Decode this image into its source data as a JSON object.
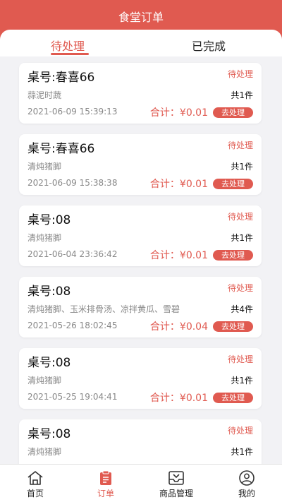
{
  "header": {
    "title": "食堂订单"
  },
  "tabs": [
    {
      "label": "待处理",
      "active": true
    },
    {
      "label": "已完成",
      "active": false
    }
  ],
  "orders": [
    {
      "table": "桌号:春喜66",
      "status": "待处理",
      "items": "蒜泥时蔬",
      "count": "共1件",
      "time": "2021-06-09 15:39:13",
      "total": "合计：¥0.01",
      "action": "去处理"
    },
    {
      "table": "桌号:春喜66",
      "status": "待处理",
      "items": "清炖猪脚",
      "count": "共1件",
      "time": "2021-06-09 15:38:38",
      "total": "合计：¥0.01",
      "action": "去处理"
    },
    {
      "table": "桌号:08",
      "status": "待处理",
      "items": "清炖猪脚",
      "count": "共1件",
      "time": "2021-06-04 23:36:42",
      "total": "合计：¥0.01",
      "action": "去处理"
    },
    {
      "table": "桌号:08",
      "status": "待处理",
      "items": "清炖猪脚、玉米排骨汤、凉拌黄瓜、雪碧",
      "count": "共4件",
      "time": "2021-05-26 18:02:45",
      "total": "合计：¥0.04",
      "action": "去处理"
    },
    {
      "table": "桌号:08",
      "status": "待处理",
      "items": "清炖猪脚",
      "count": "共1件",
      "time": "2021-05-25 19:04:41",
      "total": "合计：¥0.01",
      "action": "去处理"
    },
    {
      "table": "桌号:08",
      "status": "待处理",
      "items": "清炖猪脚",
      "count": "共1件",
      "time": "",
      "total": "",
      "action": ""
    }
  ],
  "nav": [
    {
      "label": "首页",
      "icon": "home-icon",
      "active": false
    },
    {
      "label": "订单",
      "icon": "clipboard-icon",
      "active": true
    },
    {
      "label": "商品管理",
      "icon": "inbox-icon",
      "active": false
    },
    {
      "label": "我的",
      "icon": "user-icon",
      "active": false
    }
  ],
  "colors": {
    "accent": "#e05a50",
    "background": "#f2f2f5"
  }
}
